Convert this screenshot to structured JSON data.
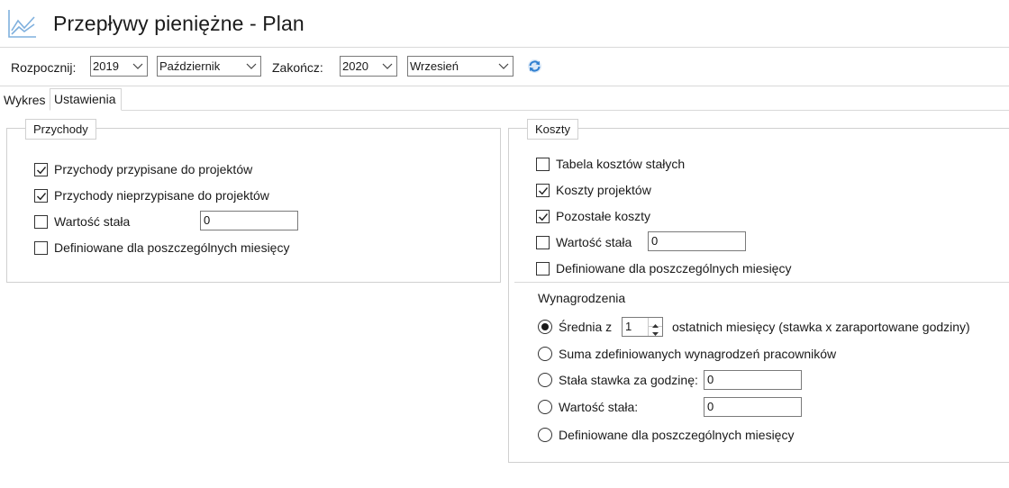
{
  "header": {
    "title": "Przepływy pieniężne - Plan",
    "icon": "line-chart-icon"
  },
  "toolbar": {
    "start_label": "Rozpocznij:",
    "start_year": "2019",
    "start_month": "Październik",
    "end_label": "Zakończ:",
    "end_year": "2020",
    "end_month": "Wrzesień",
    "refresh_icon": "refresh-icon"
  },
  "tabs": [
    {
      "label": "Wykres",
      "active": false
    },
    {
      "label": "Ustawienia",
      "active": true
    }
  ],
  "income": {
    "legend": "Przychody",
    "items": [
      {
        "label": "Przychody przypisane do projektów",
        "checked": true
      },
      {
        "label": "Przychody nieprzypisane do projektów",
        "checked": true
      },
      {
        "label": "Wartość stała",
        "checked": false,
        "value": "0"
      },
      {
        "label": "Definiowane dla poszczególnych miesięcy",
        "checked": false
      }
    ]
  },
  "costs": {
    "legend": "Koszty",
    "items": [
      {
        "label": "Tabela kosztów stałych",
        "checked": false
      },
      {
        "label": "Koszty projektów",
        "checked": true
      },
      {
        "label": "Pozostałe koszty",
        "checked": true
      },
      {
        "label": "Wartość stała",
        "checked": false,
        "value": "0"
      },
      {
        "label": "Definiowane dla poszczególnych miesięcy",
        "checked": false
      }
    ],
    "salaries": {
      "heading": "Wynagrodzenia",
      "average_prefix": "Średnia z",
      "average_months": "1",
      "average_suffix": "ostatnich miesięcy (stawka x zaraportowane godziny)",
      "sum_label": "Suma zdefiniowanych wynagrodzeń pracowników",
      "hourly_label": "Stała stawka za godzinę:",
      "hourly_value": "0",
      "fixed_label": "Wartość stała:",
      "fixed_value": "0",
      "monthly_label": "Definiowane dla poszczególnych miesięcy",
      "selected": "average"
    }
  },
  "colors": {
    "accent_icon": "#5b9bd5",
    "refresh_blue": "#2f7fd0",
    "border": "#d0d0d0"
  }
}
